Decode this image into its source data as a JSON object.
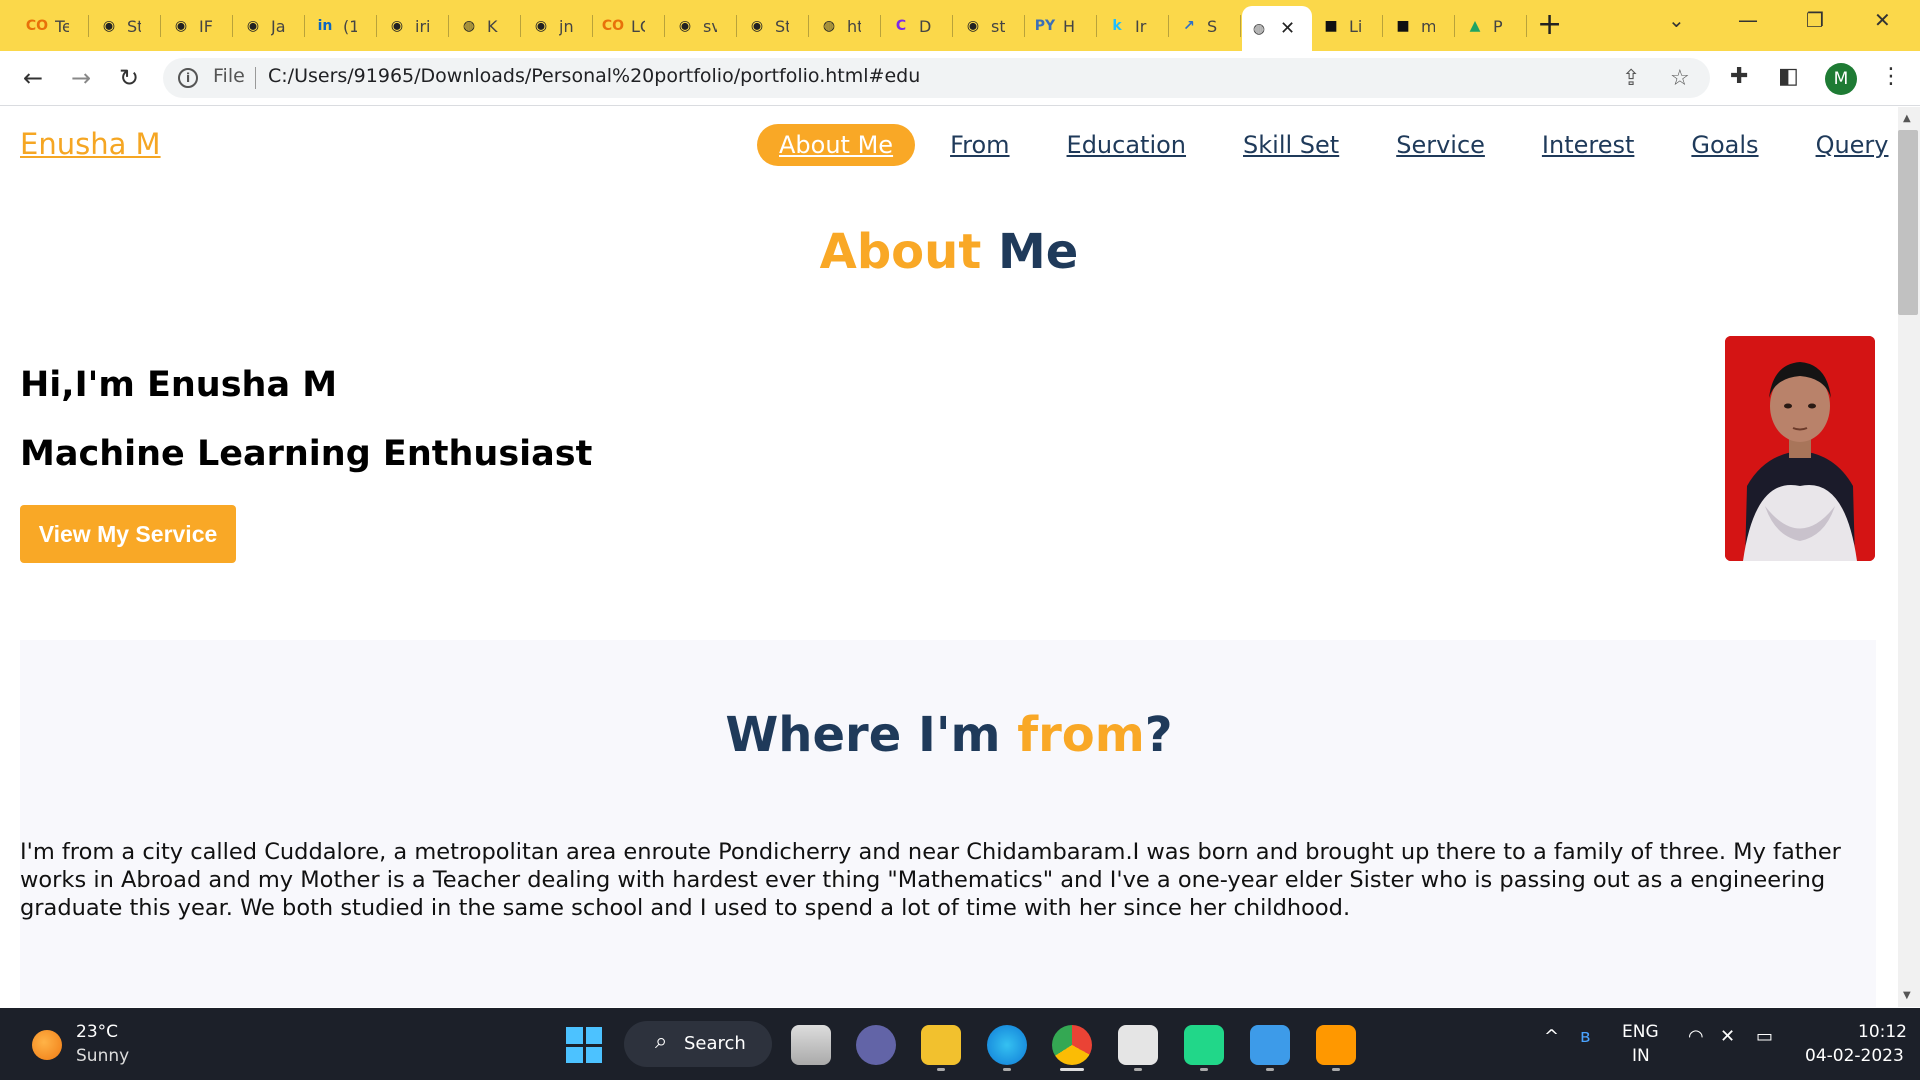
{
  "browser": {
    "tabs": [
      {
        "icon": "colab-icon",
        "glyph": "CO",
        "color": "#e8710a",
        "label": "Te"
      },
      {
        "icon": "github-icon",
        "glyph": "◉",
        "color": "#222",
        "label": "St"
      },
      {
        "icon": "github-icon",
        "glyph": "◉",
        "color": "#222",
        "label": "IF"
      },
      {
        "icon": "github-icon",
        "glyph": "◉",
        "color": "#222",
        "label": "Ja"
      },
      {
        "icon": "linkedin-icon",
        "glyph": "in",
        "color": "#0a66c2",
        "label": "(1"
      },
      {
        "icon": "github-icon",
        "glyph": "◉",
        "color": "#222",
        "label": "iri"
      },
      {
        "icon": "globe-icon",
        "glyph": "◍",
        "color": "#222",
        "label": "K"
      },
      {
        "icon": "github-icon",
        "glyph": "◉",
        "color": "#222",
        "label": "jn"
      },
      {
        "icon": "colab-icon",
        "glyph": "CO",
        "color": "#e8710a",
        "label": "LC"
      },
      {
        "icon": "github-icon",
        "glyph": "◉",
        "color": "#222",
        "label": "sv"
      },
      {
        "icon": "github-icon",
        "glyph": "◉",
        "color": "#222",
        "label": "St"
      },
      {
        "icon": "globe-icon",
        "glyph": "◍",
        "color": "#222",
        "label": "ht"
      },
      {
        "icon": "canva-icon",
        "glyph": "C",
        "color": "#7d2ae8",
        "label": "D"
      },
      {
        "icon": "github-icon",
        "glyph": "◉",
        "color": "#222",
        "label": "st"
      },
      {
        "icon": "pycharm-doc-icon",
        "glyph": "PY",
        "color": "#3b6fb6",
        "label": "H"
      },
      {
        "icon": "kaggle-icon",
        "glyph": "k",
        "color": "#20beff",
        "label": "Ir"
      },
      {
        "icon": "chart-icon",
        "glyph": "↗",
        "color": "#2a6fc9",
        "label": "S"
      }
    ],
    "active_tab": {
      "icon": "globe-icon",
      "glyph": "◍",
      "close": "✕"
    },
    "tabs_after": [
      {
        "icon": "dark-app-icon",
        "glyph": "■",
        "color": "#111",
        "label": "Li"
      },
      {
        "icon": "dark-app-icon",
        "glyph": "■",
        "color": "#111",
        "label": "m"
      },
      {
        "icon": "google-drive-icon",
        "glyph": "▲",
        "color": "#1fa463",
        "label": "P"
      }
    ],
    "new_tab": "+",
    "omnibox": {
      "scheme_label": "File",
      "url": "C:/Users/91965/Downloads/Personal%20portfolio/portfolio.html#edu"
    },
    "profile_initial": "M"
  },
  "page": {
    "logo": "Enusha M",
    "nav": [
      "About Me",
      "From",
      "Education",
      "Skill Set",
      "Service",
      "Interest",
      "Goals",
      "Query"
    ],
    "about": {
      "title_accent": "About",
      "title_rest": " Me",
      "greeting": "Hi,I'm Enusha M",
      "role": "Machine Learning Enthusiast",
      "cta": "View My Service"
    },
    "from": {
      "title_a": "Where I'm ",
      "title_accent": "from",
      "title_b": "?",
      "text": "I'm from a city called Cuddalore, a metropolitan area enroute Pondicherry and near Chidambaram.I was born and brought up there to a family of three. My father works in Abroad and my Mother is a Teacher dealing with hardest ever thing \"Mathematics\" and I've a one-year elder Sister who is passing out as a engineering graduate this year. We both studied in the same school and I used to spend a lot of time with her since her childhood."
    }
  },
  "taskbar": {
    "weather_temp": "23°C",
    "weather_desc": "Sunny",
    "search_label": "Search",
    "lang_top": "ENG",
    "lang_bottom": "IN",
    "time": "10:12",
    "date": "04-02-2023"
  },
  "colors": {
    "accent": "#f9a826",
    "navy": "#1f3a5a",
    "tabstrip": "#fbd84a"
  }
}
